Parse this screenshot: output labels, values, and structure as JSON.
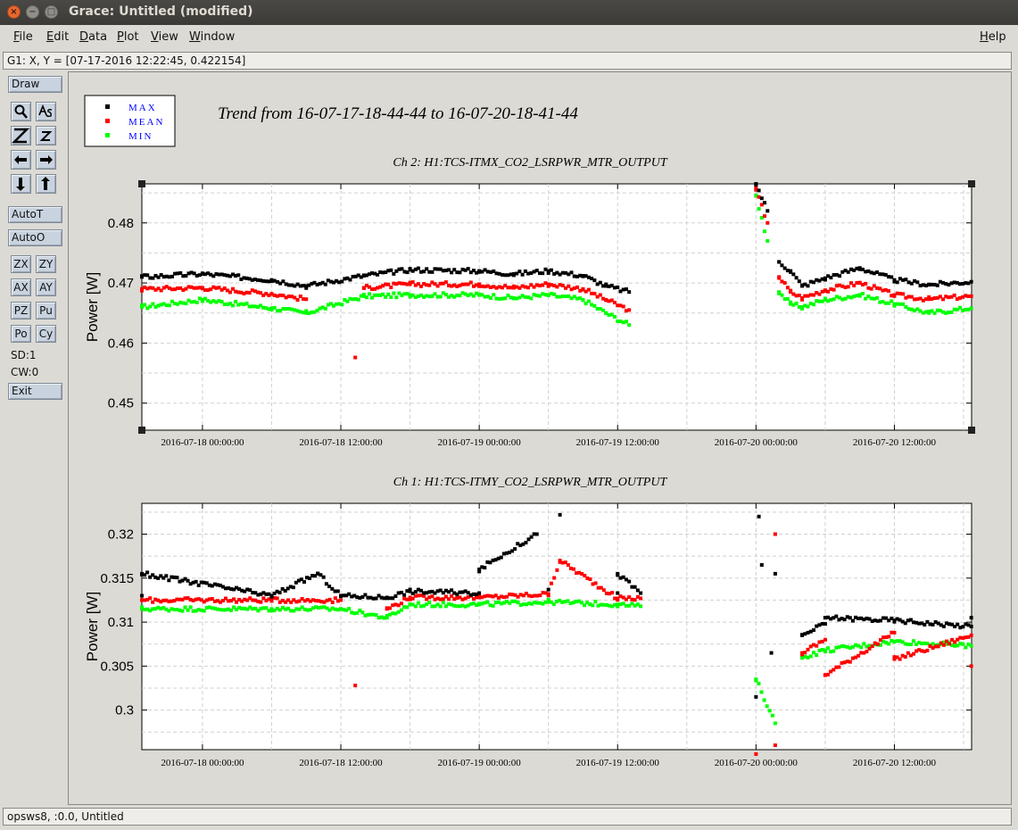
{
  "window": {
    "title": "Grace: Untitled (modified)",
    "close_glyph": "×",
    "minimize_glyph": "−",
    "maximize_glyph": "□"
  },
  "menubar": {
    "items": [
      {
        "label": "File"
      },
      {
        "label": "Edit"
      },
      {
        "label": "Data"
      },
      {
        "label": "Plot"
      },
      {
        "label": "View"
      },
      {
        "label": "Window"
      }
    ],
    "help": "Help"
  },
  "locator": "G1: X, Y = [07-17-2016 12:22:45, 0.422154]",
  "toolbar": {
    "draw": "Draw",
    "autot": "AutoT",
    "autoo": "AutoO",
    "zx": "ZX",
    "zy": "ZY",
    "ax": "AX",
    "ay": "AY",
    "pz": "PZ",
    "pu": "Pu",
    "po": "Po",
    "cy": "Cy",
    "sd": "SD:1",
    "cw": "CW:0",
    "exit": "Exit",
    "icons": [
      "zoom-icon",
      "autoscale-icon",
      "zoom-in-icon",
      "zoom-out-icon",
      "scroll-left-icon",
      "scroll-right-icon",
      "scroll-down-icon",
      "scroll-up-icon"
    ]
  },
  "legend": {
    "entries": [
      {
        "label": "MAX",
        "color": "#000000"
      },
      {
        "label": "MEAN",
        "color": "#ff0000"
      },
      {
        "label": "MIN",
        "color": "#00ff00"
      }
    ]
  },
  "main_title": "Trend from 16-07-17-18-44-44 to 16-07-20-18-41-44",
  "status": "opsws8, :0.0, Untitled",
  "colors": {
    "max": "#000000",
    "mean": "#ff0000",
    "min": "#00ff00",
    "label_blue": "#0000ff"
  },
  "chart_data": [
    {
      "type": "scatter",
      "title": "Ch 2: H1:TCS-ITMX_CO2_LSRPWR_MTR_OUTPUT",
      "ylabel": "Power [W]",
      "xlim": [
        "2016-07-17 18:44:44",
        "2016-07-20 18:41:44"
      ],
      "ylim": [
        0.4455,
        0.4865
      ],
      "yticks": [
        0.45,
        0.46,
        0.47,
        0.48
      ],
      "xticks": [
        "2016-07-18 00:00:00",
        "2016-07-18 12:00:00",
        "2016-07-19 00:00:00",
        "2016-07-19 12:00:00",
        "2016-07-20 00:00:00",
        "2016-07-20 12:00:00"
      ],
      "grid": true,
      "series": [
        {
          "name": "MAX",
          "color": "#000000",
          "points": [
            [
              "2016-07-17 18:45",
              0.471
            ],
            [
              "2016-07-18 00:00",
              0.4715
            ],
            [
              "2016-07-18 06:00",
              0.4705
            ],
            [
              "2016-07-18 09:00",
              0.4695
            ],
            [
              "2016-07-18 14:00",
              0.4712
            ],
            [
              "2016-07-18 18:00",
              0.4722
            ],
            [
              "2016-07-19 00:00",
              0.472
            ],
            [
              "2016-07-19 03:00",
              0.4715
            ],
            [
              "2016-07-19 06:00",
              0.472
            ],
            [
              "2016-07-19 09:00",
              0.4712
            ],
            [
              "2016-07-19 11:00",
              0.4695
            ],
            [
              "2016-07-19 13:00",
              0.4685
            ],
            [
              "2016-07-20 00:00",
              0.4865
            ],
            [
              "2016-07-20 01:00",
              0.482
            ],
            [
              "2016-07-20 02:00",
              0.4735
            ],
            [
              "2016-07-20 03:00",
              0.472
            ],
            [
              "2016-07-20 04:00",
              0.4695
            ],
            [
              "2016-07-20 06:00",
              0.4708
            ],
            [
              "2016-07-20 09:00",
              0.4725
            ],
            [
              "2016-07-20 12:00",
              0.4705
            ],
            [
              "2016-07-20 15:00",
              0.4697
            ],
            [
              "2016-07-20 18:40",
              0.4702
            ]
          ]
        },
        {
          "name": "MEAN",
          "color": "#ff0000",
          "points": [
            [
              "2016-07-17 18:45",
              0.469
            ],
            [
              "2016-07-18 00:00",
              0.4692
            ],
            [
              "2016-07-18 06:00",
              0.4682
            ],
            [
              "2016-07-18 09:00",
              0.4673
            ],
            [
              "2016-07-18 14:00",
              0.4692
            ],
            [
              "2016-07-18 18:00",
              0.4698
            ],
            [
              "2016-07-19 00:00",
              0.4698
            ],
            [
              "2016-07-19 03:00",
              0.4692
            ],
            [
              "2016-07-19 06:00",
              0.4698
            ],
            [
              "2016-07-19 09:00",
              0.469
            ],
            [
              "2016-07-19 11:00",
              0.4672
            ],
            [
              "2016-07-19 13:00",
              0.4655
            ],
            [
              "2016-07-20 00:00",
              0.4855
            ],
            [
              "2016-07-20 01:00",
              0.48
            ],
            [
              "2016-07-20 02:00",
              0.471
            ],
            [
              "2016-07-20 03:00",
              0.4685
            ],
            [
              "2016-07-20 04:00",
              0.4675
            ],
            [
              "2016-07-20 06:00",
              0.4688
            ],
            [
              "2016-07-20 09:00",
              0.47
            ],
            [
              "2016-07-20 12:00",
              0.468
            ],
            [
              "2016-07-20 15:00",
              0.4673
            ],
            [
              "2016-07-20 18:40",
              0.4678
            ],
            [
              "2016-07-18 13:15",
              0.4576
            ]
          ]
        },
        {
          "name": "MIN",
          "color": "#00ff00",
          "points": [
            [
              "2016-07-17 18:45",
              0.466
            ],
            [
              "2016-07-18 00:00",
              0.4672
            ],
            [
              "2016-07-18 06:00",
              0.4658
            ],
            [
              "2016-07-18 09:00",
              0.465
            ],
            [
              "2016-07-18 14:00",
              0.4678
            ],
            [
              "2016-07-18 18:00",
              0.468
            ],
            [
              "2016-07-19 00:00",
              0.468
            ],
            [
              "2016-07-19 03:00",
              0.4675
            ],
            [
              "2016-07-19 06:00",
              0.468
            ],
            [
              "2016-07-19 09:00",
              0.4672
            ],
            [
              "2016-07-19 11:00",
              0.465
            ],
            [
              "2016-07-19 13:00",
              0.463
            ],
            [
              "2016-07-20 00:00",
              0.4845
            ],
            [
              "2016-07-20 01:00",
              0.477
            ],
            [
              "2016-07-20 02:00",
              0.4685
            ],
            [
              "2016-07-20 03:00",
              0.4665
            ],
            [
              "2016-07-20 04:00",
              0.466
            ],
            [
              "2016-07-20 06:00",
              0.4672
            ],
            [
              "2016-07-20 09:00",
              0.468
            ],
            [
              "2016-07-20 12:00",
              0.4665
            ],
            [
              "2016-07-20 15:00",
              0.465
            ],
            [
              "2016-07-20 18:40",
              0.4658
            ]
          ]
        }
      ]
    },
    {
      "type": "scatter",
      "title": "Ch 1: H1:TCS-ITMY_CO2_LSRPWR_MTR_OUTPUT",
      "ylabel": "Power [W]",
      "xlim": [
        "2016-07-17 18:44:44",
        "2016-07-20 18:41:44"
      ],
      "ylim": [
        0.2955,
        0.3235
      ],
      "yticks": [
        0.3,
        0.305,
        0.31,
        0.315,
        0.32
      ],
      "xticks": [
        "2016-07-18 00:00:00",
        "2016-07-18 12:00:00",
        "2016-07-19 00:00:00",
        "2016-07-19 12:00:00",
        "2016-07-20 00:00:00",
        "2016-07-20 12:00:00"
      ],
      "grid": true,
      "series": [
        {
          "name": "MAX",
          "color": "#000000",
          "points": [
            [
              "2016-07-17 18:45",
              0.313
            ],
            [
              "2016-07-18 06:00",
              0.313
            ],
            [
              "2016-07-18 12:00",
              0.313
            ],
            [
              "2016-07-18 16:00",
              0.3128
            ],
            [
              "2016-07-18 18:00",
              0.3135
            ],
            [
              "2016-07-19 00:00",
              0.3133
            ],
            [
              "2016-07-19 06:00",
              0.3137
            ],
            [
              "2016-07-19 12:00",
              0.3133
            ],
            [
              "2016-07-19 14:00",
              0.3133
            ],
            [
              "2016-07-20 04:00",
              0.3085
            ],
            [
              "2016-07-20 06:00",
              0.3098
            ],
            [
              "2016-07-20 12:00",
              0.3102
            ],
            [
              "2016-07-20 18:40",
              0.3095
            ],
            [
              "2016-07-17 18:45",
              0.3155
            ],
            [
              "2016-07-18 10:00",
              0.3155
            ],
            [
              "2016-07-19 00:00",
              0.316
            ],
            [
              "2016-07-19 12:00",
              0.3155
            ],
            [
              "2016-07-20 06:00",
              0.3105
            ],
            [
              "2016-07-20 18:40",
              0.3105
            ],
            [
              "2016-07-19 05:00",
              0.32
            ],
            [
              "2016-07-19 07:00",
              0.3222
            ],
            [
              "2016-07-20 00:15",
              0.322
            ],
            [
              "2016-07-20 00:30",
              0.3165
            ],
            [
              "2016-07-20 01:40",
              0.3155
            ],
            [
              "2016-07-20 00:00",
              0.3015
            ],
            [
              "2016-07-20 01:20",
              0.3065
            ]
          ]
        },
        {
          "name": "MEAN",
          "color": "#ff0000",
          "points": [
            [
              "2016-07-17 18:45",
              0.3125
            ],
            [
              "2016-07-18 06:00",
              0.3125
            ],
            [
              "2016-07-18 12:00",
              0.3125
            ],
            [
              "2016-07-18 16:00",
              0.3115
            ],
            [
              "2016-07-18 18:00",
              0.3128
            ],
            [
              "2016-07-19 00:00",
              0.3128
            ],
            [
              "2016-07-19 06:00",
              0.3132
            ],
            [
              "2016-07-19 12:00",
              0.3127
            ],
            [
              "2016-07-19 14:00",
              0.3127
            ],
            [
              "2016-07-20 04:00",
              0.3065
            ],
            [
              "2016-07-20 06:00",
              0.308
            ],
            [
              "2016-07-20 12:00",
              0.3088
            ],
            [
              "2016-07-20 18:40",
              0.3085
            ],
            [
              "2016-07-20 06:00",
              0.304
            ],
            [
              "2016-07-20 12:00",
              0.3058
            ],
            [
              "2016-07-20 18:40",
              0.305
            ],
            [
              "2016-07-18 13:15",
              0.3028
            ],
            [
              "2016-07-19 07:00",
              0.317
            ],
            [
              "2016-07-20 01:40",
              0.32
            ],
            [
              "2016-07-20 01:40",
              0.296
            ],
            [
              "2016-07-20 00:00",
              0.295
            ]
          ]
        },
        {
          "name": "MIN",
          "color": "#00ff00",
          "points": [
            [
              "2016-07-17 18:45",
              0.3115
            ],
            [
              "2016-07-18 06:00",
              0.3115
            ],
            [
              "2016-07-18 12:00",
              0.3115
            ],
            [
              "2016-07-18 16:00",
              0.3105
            ],
            [
              "2016-07-18 18:00",
              0.312
            ],
            [
              "2016-07-19 00:00",
              0.312
            ],
            [
              "2016-07-19 06:00",
              0.3123
            ],
            [
              "2016-07-19 12:00",
              0.312
            ],
            [
              "2016-07-19 14:00",
              0.3118
            ],
            [
              "2016-07-20 04:00",
              0.306
            ],
            [
              "2016-07-20 06:00",
              0.3068
            ],
            [
              "2016-07-20 12:00",
              0.3078
            ],
            [
              "2016-07-20 18:40",
              0.3073
            ],
            [
              "2016-07-20 00:00",
              0.3035
            ],
            [
              "2016-07-20 01:40",
              0.2985
            ]
          ]
        }
      ]
    }
  ]
}
